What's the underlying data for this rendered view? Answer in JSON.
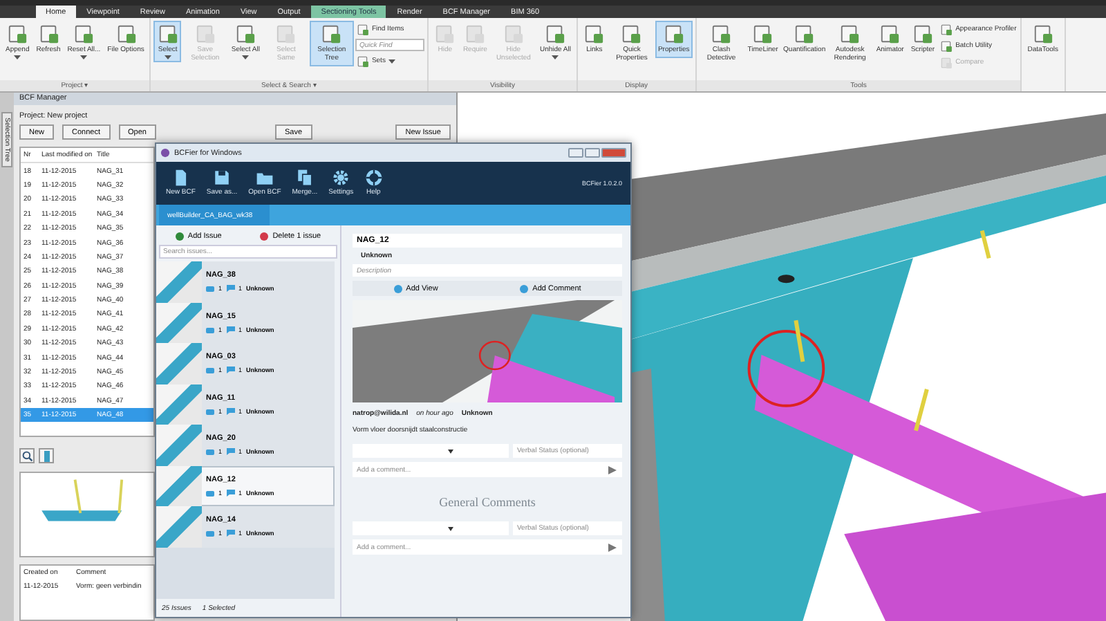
{
  "ribbon": {
    "tabs": [
      {
        "label": "Home",
        "selected": true,
        "kind": "normal"
      },
      {
        "label": "Viewpoint",
        "selected": false,
        "kind": "normal"
      },
      {
        "label": "Review",
        "selected": false,
        "kind": "normal"
      },
      {
        "label": "Animation",
        "selected": false,
        "kind": "normal"
      },
      {
        "label": "View",
        "selected": false,
        "kind": "normal"
      },
      {
        "label": "Output",
        "selected": false,
        "kind": "normal"
      },
      {
        "label": "Sectioning Tools",
        "selected": false,
        "kind": "contextual"
      },
      {
        "label": "Render",
        "selected": false,
        "kind": "normal"
      },
      {
        "label": "BCF Manager",
        "selected": false,
        "kind": "normal"
      },
      {
        "label": "BIM 360",
        "selected": false,
        "kind": "normal"
      }
    ],
    "groups": [
      {
        "label": "Project ▾",
        "items": [
          {
            "label": "Append",
            "kind": "large",
            "selected": false,
            "disabled": false,
            "menu": true
          },
          {
            "label": "Refresh",
            "kind": "large",
            "selected": false,
            "disabled": false,
            "menu": false
          },
          {
            "label": "Reset All...",
            "kind": "large",
            "selected": false,
            "disabled": false,
            "menu": true
          },
          {
            "label": "File Options",
            "kind": "large",
            "selected": false,
            "disabled": false,
            "menu": false
          }
        ]
      },
      {
        "label": "Select & Search ▾",
        "items": [
          {
            "label": "Select",
            "kind": "large",
            "selected": true,
            "disabled": false,
            "menu": true
          },
          {
            "label": "Save Selection",
            "kind": "large",
            "selected": false,
            "disabled": true,
            "menu": false
          },
          {
            "label": "Select All",
            "kind": "large",
            "selected": false,
            "disabled": false,
            "menu": true
          },
          {
            "label": "Select Same",
            "kind": "large",
            "selected": false,
            "disabled": true,
            "menu": false
          },
          {
            "label": "Selection Tree",
            "kind": "large",
            "selected": true,
            "disabled": false,
            "menu": false
          },
          {
            "label": "Find Items",
            "kind": "small",
            "selected": false,
            "disabled": false,
            "menu": false
          },
          {
            "placeholder": "Quick Find",
            "kind": "field"
          },
          {
            "label": "Sets",
            "kind": "small",
            "selected": false,
            "disabled": false,
            "menu": true
          }
        ]
      },
      {
        "label": "Visibility",
        "items": [
          {
            "label": "Hide",
            "kind": "large",
            "selected": false,
            "disabled": true,
            "menu": false
          },
          {
            "label": "Require",
            "kind": "large",
            "selected": false,
            "disabled": true,
            "menu": false
          },
          {
            "label": "Hide Unselected",
            "kind": "large",
            "selected": false,
            "disabled": true,
            "menu": false
          },
          {
            "label": "Unhide All",
            "kind": "large",
            "selected": false,
            "disabled": false,
            "menu": true
          }
        ]
      },
      {
        "label": "Display",
        "items": [
          {
            "label": "Links",
            "kind": "large",
            "selected": false,
            "disabled": false,
            "menu": false
          },
          {
            "label": "Quick Properties",
            "kind": "large",
            "selected": false,
            "disabled": false,
            "menu": false
          },
          {
            "label": "Properties",
            "kind": "large",
            "selected": true,
            "disabled": false,
            "menu": false
          }
        ]
      },
      {
        "label": "Tools",
        "items": [
          {
            "label": "Clash Detective",
            "kind": "large",
            "selected": false,
            "disabled": false,
            "menu": false
          },
          {
            "label": "TimeLiner",
            "kind": "large",
            "selected": false,
            "disabled": false,
            "menu": false
          },
          {
            "label": "Quantification",
            "kind": "large",
            "selected": false,
            "disabled": false,
            "menu": false
          },
          {
            "label": "Autodesk Rendering",
            "kind": "large",
            "selected": false,
            "disabled": false,
            "menu": false
          },
          {
            "label": "Animator",
            "kind": "large",
            "selected": false,
            "disabled": false,
            "menu": false
          },
          {
            "label": "Scripter",
            "kind": "large",
            "selected": false,
            "disabled": false,
            "menu": false
          },
          {
            "label": "Appearance Profiler",
            "kind": "small",
            "selected": false,
            "disabled": false,
            "menu": false
          },
          {
            "label": "Batch Utility",
            "kind": "small",
            "selected": false,
            "disabled": false,
            "menu": false
          },
          {
            "label": "Compare",
            "kind": "small",
            "selected": false,
            "disabled": true,
            "menu": false
          }
        ]
      },
      {
        "items": [
          {
            "label": "DataTools",
            "kind": "large",
            "selected": false,
            "disabled": false,
            "menu": false
          }
        ]
      }
    ]
  },
  "side_strip": {
    "tabs": [
      "Selection Tree"
    ]
  },
  "manager": {
    "title": "BCF Manager",
    "project": "Project: New project",
    "buttons": [
      "New",
      "Connect",
      "Open",
      "Save",
      "New Issue"
    ],
    "columns": [
      "Nr",
      "Last modified on",
      "Title"
    ],
    "rows": [
      {
        "cells": [
          "18",
          "11-12-2015",
          "NAG_31"
        ],
        "selected": false
      },
      {
        "cells": [
          "19",
          "11-12-2015",
          "NAG_32"
        ],
        "selected": false
      },
      {
        "cells": [
          "20",
          "11-12-2015",
          "NAG_33"
        ],
        "selected": false
      },
      {
        "cells": [
          "21",
          "11-12-2015",
          "NAG_34"
        ],
        "selected": false
      },
      {
        "cells": [
          "22",
          "11-12-2015",
          "NAG_35"
        ],
        "selected": false
      },
      {
        "cells": [
          "23",
          "11-12-2015",
          "NAG_36"
        ],
        "selected": false
      },
      {
        "cells": [
          "24",
          "11-12-2015",
          "NAG_37"
        ],
        "selected": false
      },
      {
        "cells": [
          "25",
          "11-12-2015",
          "NAG_38"
        ],
        "selected": false
      },
      {
        "cells": [
          "26",
          "11-12-2015",
          "NAG_39"
        ],
        "selected": false
      },
      {
        "cells": [
          "27",
          "11-12-2015",
          "NAG_40"
        ],
        "selected": false
      },
      {
        "cells": [
          "28",
          "11-12-2015",
          "NAG_41"
        ],
        "selected": false
      },
      {
        "cells": [
          "29",
          "11-12-2015",
          "NAG_42"
        ],
        "selected": false
      },
      {
        "cells": [
          "30",
          "11-12-2015",
          "NAG_43"
        ],
        "selected": false
      },
      {
        "cells": [
          "31",
          "11-12-2015",
          "NAG_44"
        ],
        "selected": false
      },
      {
        "cells": [
          "32",
          "11-12-2015",
          "NAG_45"
        ],
        "selected": false
      },
      {
        "cells": [
          "33",
          "11-12-2015",
          "NAG_46"
        ],
        "selected": false
      },
      {
        "cells": [
          "34",
          "11-12-2015",
          "NAG_47"
        ],
        "selected": false
      },
      {
        "cells": [
          "35",
          "11-12-2015",
          "NAG_48"
        ],
        "selected": true
      }
    ],
    "comments": {
      "columns": [
        "Created on",
        "Comment"
      ],
      "rows": [
        [
          "11-12-2015",
          "Vorm: geen verbindin"
        ]
      ]
    }
  },
  "bcfier": {
    "title": "BCFier for Windows",
    "version": "BCFier 1.0.2.0",
    "toolbar": [
      {
        "label": "New BCF",
        "kind": "new"
      },
      {
        "label": "Save as...",
        "kind": "save"
      },
      {
        "label": "Open BCF",
        "kind": "open"
      },
      {
        "label": "Merge...",
        "kind": "merge"
      },
      {
        "label": "Settings",
        "kind": "settings"
      },
      {
        "label": "Help",
        "kind": "help"
      }
    ],
    "tabs": [
      {
        "label": "wellBuilder_CA_BAG_wk38",
        "selected": true
      }
    ],
    "add_issue": "Add Issue",
    "delete_issue": "Delete 1 issue",
    "search_placeholder": "Search issues...",
    "issues": [
      {
        "title": "NAG_38",
        "views": "1",
        "comments": "1",
        "status": "Unknown",
        "selected": false
      },
      {
        "title": "NAG_15",
        "views": "1",
        "comments": "1",
        "status": "Unknown",
        "selected": false
      },
      {
        "title": "NAG_03",
        "views": "1",
        "comments": "1",
        "status": "Unknown",
        "selected": false
      },
      {
        "title": "NAG_11",
        "views": "1",
        "comments": "1",
        "status": "Unknown",
        "selected": false
      },
      {
        "title": "NAG_20",
        "views": "1",
        "comments": "1",
        "status": "Unknown",
        "selected": false
      },
      {
        "title": "NAG_12",
        "views": "1",
        "comments": "1",
        "status": "Unknown",
        "selected": true
      },
      {
        "title": "NAG_14",
        "views": "1",
        "comments": "1",
        "status": "Unknown",
        "selected": false
      }
    ],
    "footer": {
      "count": "25 Issues",
      "selection": "1 Selected"
    },
    "detail": {
      "title": "NAG_12",
      "status": "Unknown",
      "description_placeholder": "Description",
      "add_view": "Add View",
      "add_comment": "Add Comment",
      "comment": {
        "author": "natrop@wilida.nl",
        "time": "on hour ago",
        "status": "Unknown",
        "text": "Vorm vloer doorsnijdt staalconstructie"
      },
      "comment_form": {
        "status_placeholder": "Verbal Status (optional)",
        "comment_placeholder": "Add a comment..."
      },
      "general_heading": "General Comments",
      "general_form": {
        "status_placeholder": "Verbal Status (optional)",
        "comment_placeholder": "Add a comment..."
      }
    }
  }
}
